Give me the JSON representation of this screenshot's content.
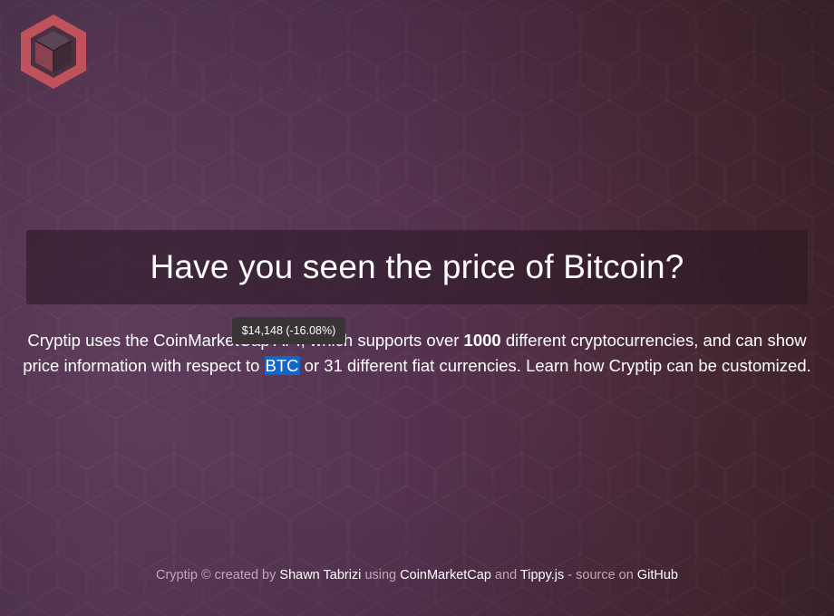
{
  "title": "Have you seen the price of Bitcoin?",
  "description": {
    "part1": "Cryptip uses the CoinMarketCap API, which supports over ",
    "count": "1000",
    "part2": " different cryptocurrencies, and can show price information with respect to ",
    "highlight": "BTC",
    "part3": " or 31 different fiat currencies. Learn how Cryptip can be customized."
  },
  "tooltip": {
    "text": "$14,148 (-16.08%)"
  },
  "footer": {
    "t1": "Cryptip © created by ",
    "author": "Shawn Tabrizi",
    "t2": " using ",
    "link_cmc": "CoinMarketCap",
    "t3": " and ",
    "link_tippy": "Tippy.js",
    "t4": " - source on ",
    "link_github": "GitHub"
  },
  "logo": {
    "icon": "cube-logo-icon",
    "colors": {
      "outer": "#c0525c",
      "top": "#4e3a4a",
      "side": "#3a2a36"
    }
  },
  "colors": {
    "highlight": "#1166c8",
    "tooltip_bg": "#3b3436",
    "title_band": "#281620"
  }
}
